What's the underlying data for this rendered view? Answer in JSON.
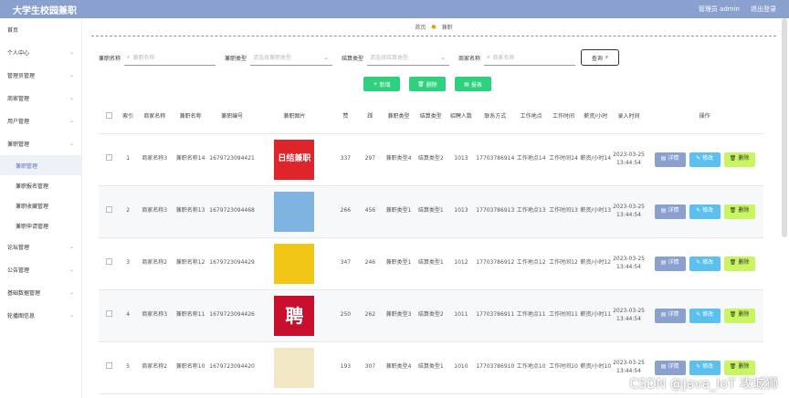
{
  "app_title": "大学生校园兼职",
  "header": {
    "user": "管理员 admin",
    "logout": "退出登录"
  },
  "sidebar": {
    "items": [
      {
        "label": "首页",
        "has_chevron": false
      },
      {
        "label": "个人中心",
        "has_chevron": true
      },
      {
        "label": "管理员管理",
        "has_chevron": true
      },
      {
        "label": "商家管理",
        "has_chevron": true
      },
      {
        "label": "用户管理",
        "has_chevron": true
      },
      {
        "label": "兼职管理",
        "has_chevron": true
      }
    ],
    "sub_items": [
      "兼职管理",
      "兼职报名管理",
      "兼职收藏管理",
      "兼职申请管理"
    ],
    "items_after": [
      {
        "label": "论坛管理"
      },
      {
        "label": "公告管理"
      },
      {
        "label": "基础数据管理"
      },
      {
        "label": "轮播图信息"
      }
    ]
  },
  "breadcrumb": {
    "home": "首页",
    "current": "兼职"
  },
  "search": {
    "label1": "兼职名称",
    "placeholder1": "兼职名称",
    "label2": "兼职类型",
    "placeholder2": "请选择兼职类型",
    "label3": "结算类型",
    "placeholder3": "请选择结算类型",
    "label4": "商家名称",
    "placeholder4": "商家名称",
    "query_btn": "查询"
  },
  "toolbar": {
    "add": "新增",
    "delete": "删除",
    "report": "报表"
  },
  "table": {
    "headers": [
      "索引",
      "商家名称",
      "兼职名称",
      "兼职编号",
      "兼职图片",
      "赞",
      "踩",
      "兼职类型",
      "结算类型",
      "招聘人数",
      "联系方式",
      "工作地点",
      "工作时间",
      "薪资/小时",
      "录入时间",
      "操作"
    ],
    "rows": [
      {
        "idx": "1",
        "shop": "商家名称3",
        "name": "兼职名称14",
        "code": "1679723094421",
        "img_text": "日结兼职",
        "img_color": "#e0242b",
        "like": "337",
        "dislike": "297",
        "type": "兼职类型4",
        "settle": "结算类型2",
        "count": "1013",
        "phone": "17703786914",
        "place": "工作地点14",
        "time": "工作时间14",
        "salary": "薪资/小时14",
        "date": "2023-03-25 13:44:54"
      },
      {
        "idx": "2",
        "shop": "商家名称3",
        "name": "兼职名称13",
        "code": "1679723094468",
        "img_text": "",
        "img_color": "#7fb3e0",
        "like": "266",
        "dislike": "456",
        "type": "兼职类型1",
        "settle": "结算类型1",
        "count": "1013",
        "phone": "17703786913",
        "place": "工作地点13",
        "time": "工作时间13",
        "salary": "薪资/小时13",
        "date": "2023-03-25 13:44:54"
      },
      {
        "idx": "3",
        "shop": "商家名称2",
        "name": "兼职名称12",
        "code": "1679723094429",
        "img_text": "",
        "img_color": "#f2c617",
        "like": "347",
        "dislike": "246",
        "type": "兼职类型1",
        "settle": "结算类型1",
        "count": "1012",
        "phone": "17703786912",
        "place": "工作地点12",
        "time": "工作时间12",
        "salary": "薪资/小时12",
        "date": "2023-03-25 13:44:54"
      },
      {
        "idx": "4",
        "shop": "商家名称3",
        "name": "兼职名称11",
        "code": "1679723094426",
        "img_text": "聘",
        "img_color": "#c8102e",
        "like": "250",
        "dislike": "262",
        "type": "兼职类型3",
        "settle": "结算类型2",
        "count": "1011",
        "phone": "17703786911",
        "place": "工作地点11",
        "time": "工作时间11",
        "salary": "薪资/小时11",
        "date": "2023-03-25 13:44:54"
      },
      {
        "idx": "5",
        "shop": "商家名称2",
        "name": "兼职名称10",
        "code": "1679723094420",
        "img_text": "",
        "img_color": "#f1e7c4",
        "like": "193",
        "dislike": "307",
        "type": "兼职类型4",
        "settle": "结算类型1",
        "count": "1010",
        "phone": "17703786910",
        "place": "工作地点10",
        "time": "工作时间10",
        "salary": "薪资/小时10",
        "date": "2023-03-25 13:44:54"
      }
    ],
    "ops": {
      "detail": "详情",
      "edit": "修改",
      "del": "删除"
    }
  },
  "watermark": "CSDN @Java_IoT 攻城狮"
}
